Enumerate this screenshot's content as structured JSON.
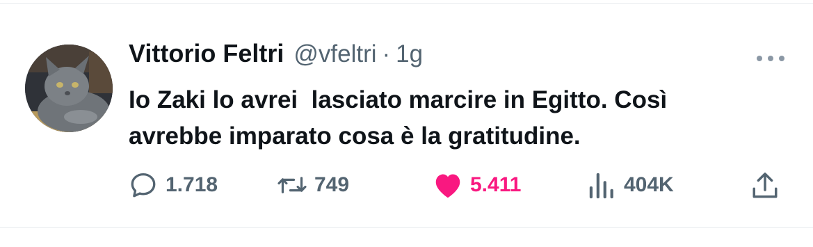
{
  "tweet": {
    "author": {
      "name": "Vittorio Feltri",
      "handle": "@vfeltri",
      "avatar": "cat-avatar-icon"
    },
    "separator": "·",
    "time": "1g",
    "text": "Io Zaki lo avrei  lasciato marcire in Egitto. Così\navrebbe imparato cosa è la gratitudine.",
    "more_icon": "more-dots-icon",
    "actions": {
      "replies": {
        "icon": "reply-icon",
        "count": "1.718"
      },
      "retweets": {
        "icon": "retweet-icon",
        "count": "749"
      },
      "likes": {
        "icon": "heart-icon",
        "count": "5.411",
        "liked": true,
        "color": "#f91880"
      },
      "views": {
        "icon": "views-icon",
        "count": "404K"
      },
      "share": {
        "icon": "share-icon"
      }
    }
  },
  "colors": {
    "text": "#0f1419",
    "secondary": "#536471",
    "like": "#f91880",
    "divider": "#e6e9ec"
  }
}
